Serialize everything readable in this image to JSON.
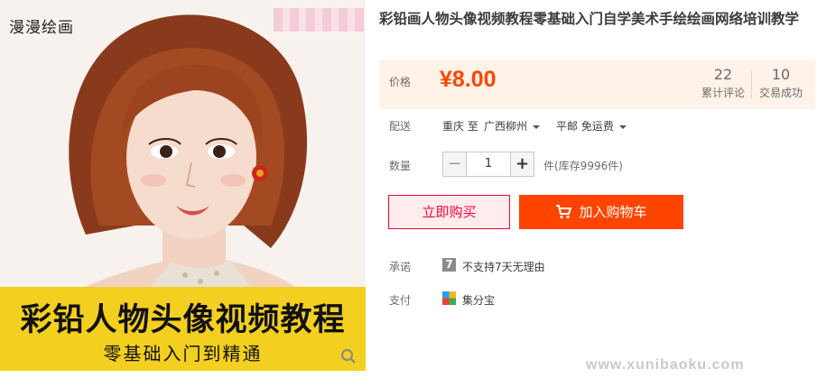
{
  "gallery": {
    "brand_mark": "漫漫绘画",
    "banner_title": "彩铅人物头像视频教程",
    "banner_subtitle": "零基础入门到精通"
  },
  "product": {
    "title": "彩铅画人物头像视频教程零基础入门自学美术手绘绘画网络培训教学",
    "price_label": "价格",
    "price": "¥8.00",
    "reviews_count": "22",
    "reviews_label": "累计评论",
    "sales_count": "10",
    "sales_label": "交易成功"
  },
  "shipping": {
    "label": "配送",
    "from": "重庆 至",
    "to": "广西柳州",
    "method": "平邮 免运费"
  },
  "quantity": {
    "label": "数量",
    "minus": "−",
    "value": "1",
    "plus": "+",
    "stock": "件(库存9996件)"
  },
  "actions": {
    "buy_now": "立即购买",
    "add_to_cart": "加入购物车"
  },
  "promise": {
    "label": "承诺",
    "icon_text": "7",
    "text": "不支持7天无理由"
  },
  "payment": {
    "label": "支付",
    "text": "集分宝"
  },
  "watermark": "www.xunibaoku.com",
  "colors": {
    "accent": "#ff4400",
    "buy_border": "#ff0036",
    "price_bg": "#fff2e8",
    "banner": "#f3cf1f"
  }
}
